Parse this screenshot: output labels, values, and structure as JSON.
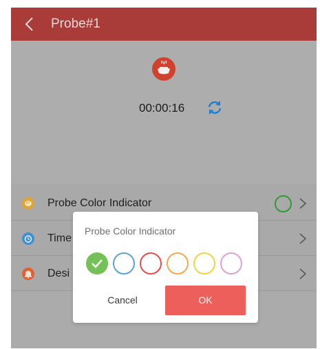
{
  "navbar": {
    "title": "Probe#1",
    "back_icon": "chevron-left-icon",
    "color": "#a93b39"
  },
  "hero": {
    "cook_icon": "cooking-pot-icon",
    "timer": "00:00:16",
    "refresh_icon": "refresh-icon"
  },
  "settings": {
    "items": [
      {
        "label": "Probe Color Indicator",
        "icon": "palette-icon",
        "icon_color": "#e0a437",
        "selected_color": "#2e9c33"
      },
      {
        "label": "Time",
        "icon": "alarm-clock-icon",
        "icon_color": "#3f8fd4"
      },
      {
        "label": "Desi",
        "icon": "bell-icon",
        "icon_color": "#e06131"
      }
    ]
  },
  "dialog": {
    "title": "Probe Color Indicator",
    "colors": [
      {
        "name": "green",
        "hex": "#74c158",
        "selected": true
      },
      {
        "name": "blue",
        "hex": "#5b9fdb",
        "selected": false
      },
      {
        "name": "red",
        "hex": "#e84a48",
        "selected": false
      },
      {
        "name": "orange",
        "hex": "#f3a74a",
        "selected": false
      },
      {
        "name": "yellow",
        "hex": "#ecd544",
        "selected": false
      },
      {
        "name": "pink",
        "hex": "#dfa0d2",
        "selected": false
      }
    ],
    "cancel_label": "Cancel",
    "ok_label": "OK",
    "ok_color": "#ec5f5b"
  }
}
